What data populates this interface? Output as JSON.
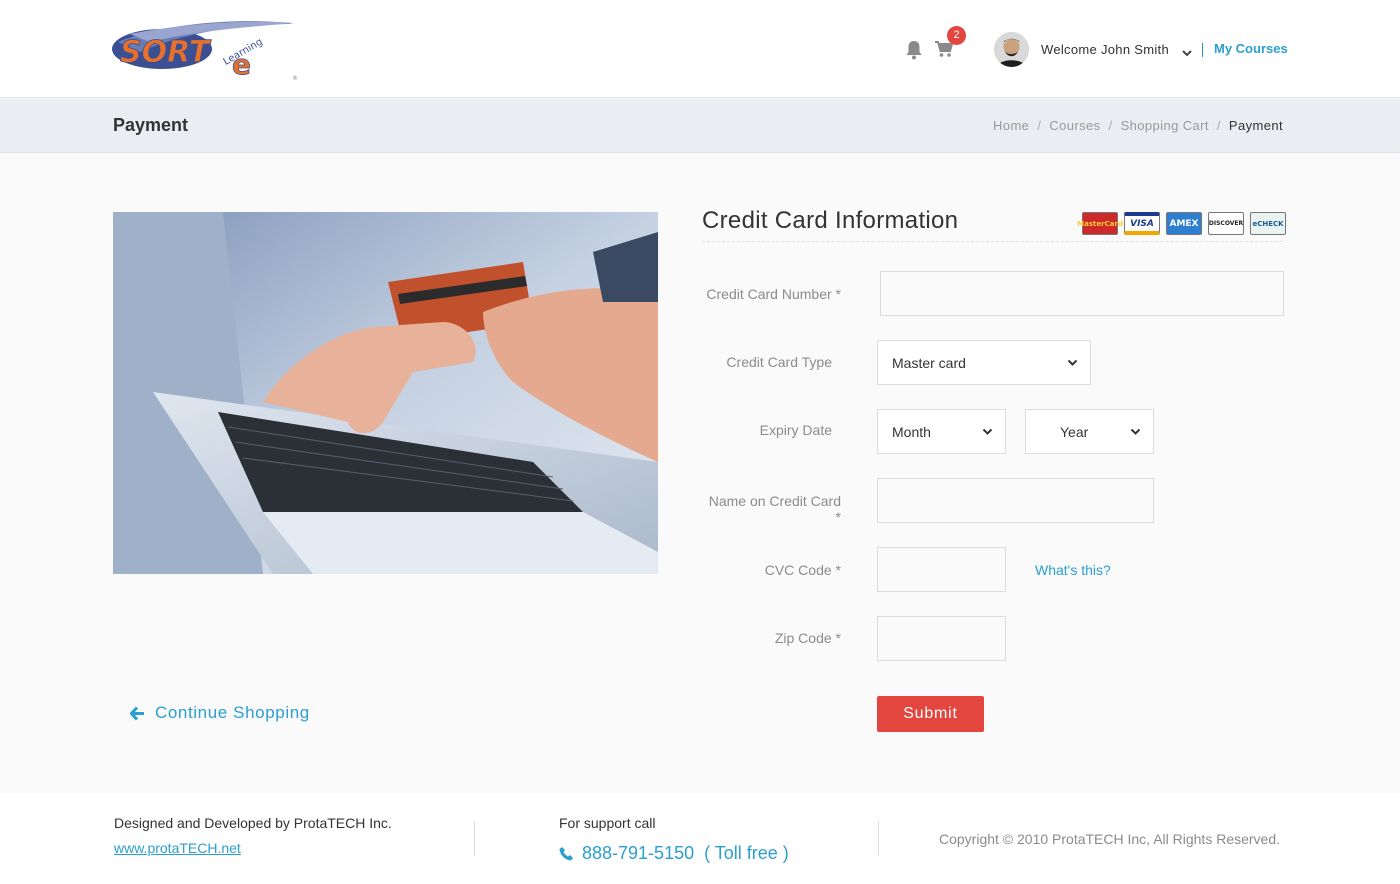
{
  "header": {
    "logo": {
      "main": "SORT",
      "accent": "e",
      "sub": "Learning",
      "mark": "®"
    },
    "cart_count": "2",
    "welcome": "Welcome John Smith",
    "my_courses": "My Courses"
  },
  "titlebar": {
    "title": "Payment",
    "breadcrumb": [
      "Home",
      "Courses",
      "Shopping Cart",
      "Payment"
    ]
  },
  "form": {
    "title": "Credit Card Information",
    "card_logos": [
      "MasterCard",
      "VISA",
      "AMEX",
      "DISCOVER",
      "eCHECK"
    ],
    "labels": {
      "card_number": "Credit Card Number *",
      "card_type": "Credit Card Type",
      "expiry": "Expiry Date",
      "name": "Name on Credit Card *",
      "cvc": "CVC Code *",
      "zip": "Zip Code *"
    },
    "card_type_value": "Master card",
    "expiry_month": "Month",
    "expiry_year": "Year",
    "whats_this": "What's this?",
    "submit": "Submit"
  },
  "continue_shopping": "Continue Shopping",
  "footer": {
    "designed": "Designed and Developed by ProtaTECH Inc.",
    "link": "www.protaTECH.net",
    "support": "For support call",
    "phone": "888-791-5150  ( Toll free )",
    "copyright": "Copyright © 2010 ProtaTECH Inc, All Rights Reserved."
  },
  "colors": {
    "accent": "#2a9fd0",
    "submit": "#e3463f",
    "logo_orange": "#e8702a",
    "logo_blue": "#3b4f93"
  }
}
